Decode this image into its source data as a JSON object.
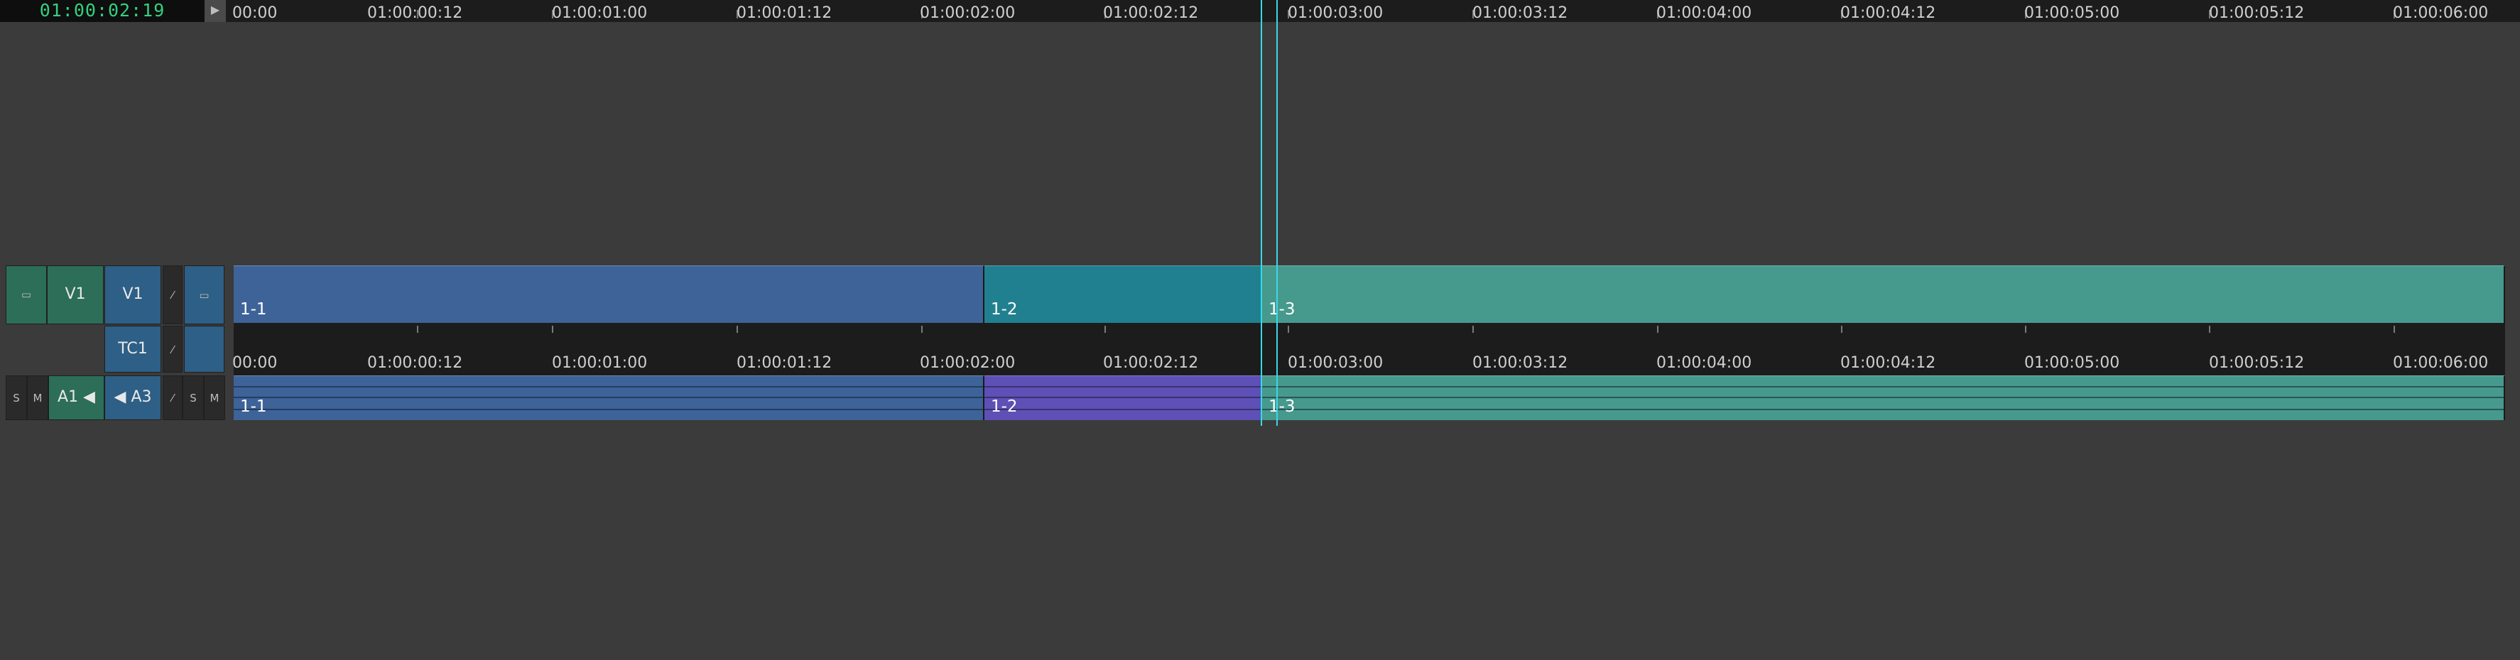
{
  "timecode": "01:00:02:19",
  "play_glyph": "▶",
  "ruler_labels": [
    "00:00",
    "01:00:00:12",
    "01:00:01:00",
    "01:00:01:12",
    "01:00:02:00",
    "01:00:02:12",
    "01:00:03:00",
    "01:00:03:12",
    "01:00:04:00",
    "01:00:04:12",
    "01:00:05:00",
    "01:00:05:12",
    "01:00:06:00"
  ],
  "tracks": {
    "video": {
      "source": "V1",
      "record": "V1"
    },
    "timecode": {
      "record": "TC1"
    },
    "audio": {
      "solo": "S",
      "mute": "M",
      "source": "A1",
      "record": "A3",
      "solo2": "S",
      "mute2": "M"
    }
  },
  "video_clips": [
    {
      "label": "1-1",
      "color": "#3d6399"
    },
    {
      "label": "1-2",
      "color": "#21808f"
    },
    {
      "label": "1-3",
      "color": "#46998d"
    }
  ],
  "audio_clips": [
    {
      "label": "1-1",
      "color": "#3d6399"
    },
    {
      "label": "1-2",
      "color": "#5e50b6"
    },
    {
      "label": "1-3",
      "color": "#46998d"
    }
  ],
  "colors": {
    "timecode": "#35d07f",
    "playhead": "#38d8ea",
    "background": "#3b3b3b",
    "track_header": "#2e5f86",
    "source_header": "#2c6e57"
  }
}
